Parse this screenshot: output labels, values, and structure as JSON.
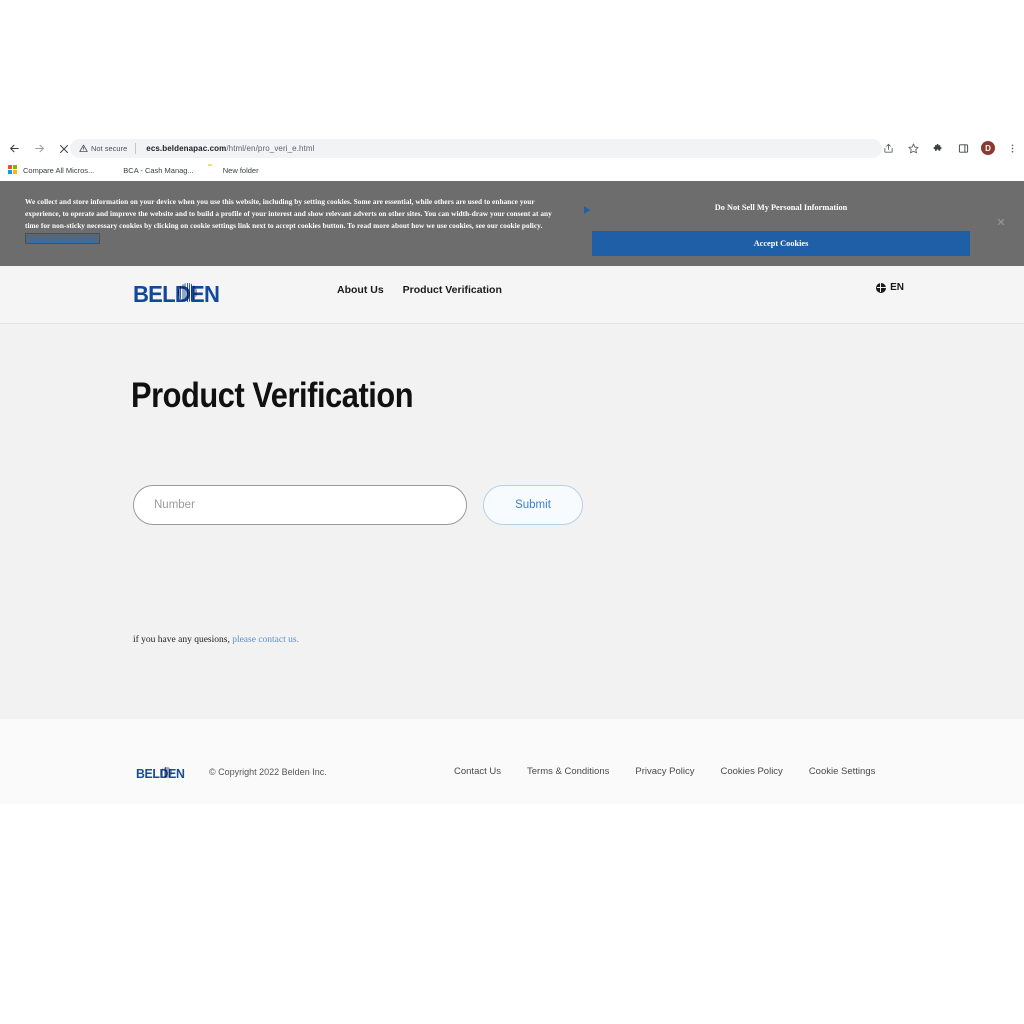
{
  "browser": {
    "nav": {
      "back_icon": "arrow-left-icon",
      "forward_icon": "arrow-right-icon",
      "stop_icon": "close-icon"
    },
    "omnibox": {
      "security_label": "Not secure",
      "security_icon": "warning-triangle-icon",
      "host": "ecs.beldenapac.com",
      "path": "/html/en/pro_veri_e.html"
    },
    "toolbar_icons": [
      "share-icon",
      "star-icon",
      "extensions-puzzle-icon",
      "sidepanel-icon"
    ],
    "profile_initial": "D",
    "menu_icon": "kebab-menu-icon",
    "bookmarks": [
      {
        "label": "Compare All Micros...",
        "icon": "microsoft-logo-icon"
      },
      {
        "label": "BCA - Cash Manag...",
        "icon": "bca-icon"
      },
      {
        "label": "New folder",
        "icon": "folder-icon"
      }
    ]
  },
  "cookie_banner": {
    "body_text": "We collect and store information on your device when you use this website, including by setting cookies. Some are essential, while others are used to enhance your experience, to operate and improve the website and to build a profile of your interest and show relevant adverts on other sites. You can width-draw your consent at any time for non-sticky necessary cookies by clicking on cookie settings link next to accept cookies button. To read more about how we use cookies, see our cookie policy.",
    "policy_link": "Cookie Consent Policy",
    "do_not_sell": "Do Not Sell My Personal Information",
    "accept_label": "Accept Cookies",
    "close_icon": "close-icon",
    "arrow_icon": "play-triangle-icon",
    "background_color": "#6d6d6d",
    "accent_color": "#1f5fa8"
  },
  "site_header": {
    "logo_text": "BELDEN",
    "nav": [
      {
        "label": "About Us"
      },
      {
        "label": "Product Verification"
      }
    ],
    "language": {
      "label": "EN",
      "icon": "globe-icon"
    },
    "brand_color": "#12499a"
  },
  "main": {
    "title": "Product Verification",
    "input": {
      "placeholder": "Number",
      "value": ""
    },
    "submit_label": "Submit",
    "contact_prefix": "if you have any quesions,",
    "contact_link": "please contact us."
  },
  "footer": {
    "logo_text": "BELDEN",
    "copyright": "© Copyright 2022 Belden Inc.",
    "links": [
      {
        "label": "Contact Us"
      },
      {
        "label": "Terms & Conditions"
      },
      {
        "label": "Privacy Policy"
      },
      {
        "label": "Cookies Policy"
      },
      {
        "label": "Cookie Settings"
      }
    ]
  }
}
